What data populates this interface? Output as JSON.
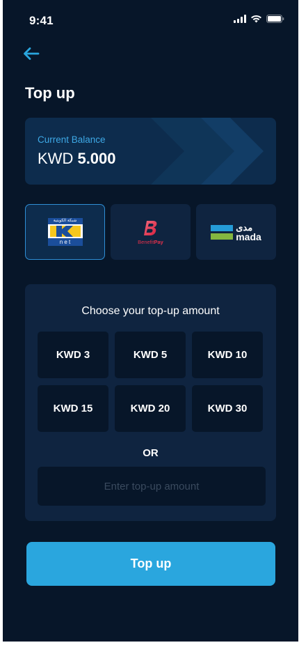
{
  "status": {
    "time": "9:41",
    "signal_icon": "signal-icon",
    "wifi_icon": "wifi-icon",
    "battery_icon": "battery-icon"
  },
  "header": {
    "back_icon": "arrow-left-icon",
    "title": "Top up"
  },
  "balance": {
    "label": "Current Balance",
    "currency": "KWD",
    "amount": "5.000"
  },
  "payment_methods": [
    {
      "name": "KNET",
      "selected": true
    },
    {
      "name": "BenefitPay",
      "selected": false,
      "text_prefix": "Benefit",
      "text_suffix": "Pay"
    },
    {
      "name": "mada",
      "selected": false,
      "arabic": "مدى",
      "latin": "mada"
    }
  ],
  "knet_logo_text": {
    "arabic": "شبكة الكويتية",
    "latin": "n e t",
    "letter": "K"
  },
  "amounts": {
    "title": "Choose your top-up amount",
    "options": [
      "KWD 3",
      "KWD 5",
      "KWD 10",
      "KWD 15",
      "KWD 20",
      "KWD 30"
    ],
    "or_label": "OR",
    "input_placeholder": "Enter top-up amount",
    "input_value": ""
  },
  "submit": {
    "label": "Top up"
  },
  "colors": {
    "background": "#071629",
    "card": "#0f2440",
    "balance_card": "#0d2c4d",
    "accent": "#2aa6de",
    "label_blue": "#3ea9e6",
    "knet_blue": "#1b4e9b",
    "knet_yellow": "#f6c71d",
    "benefit_red": "#e3304b",
    "mada_blue": "#259bd6",
    "mada_green": "#84b740"
  }
}
